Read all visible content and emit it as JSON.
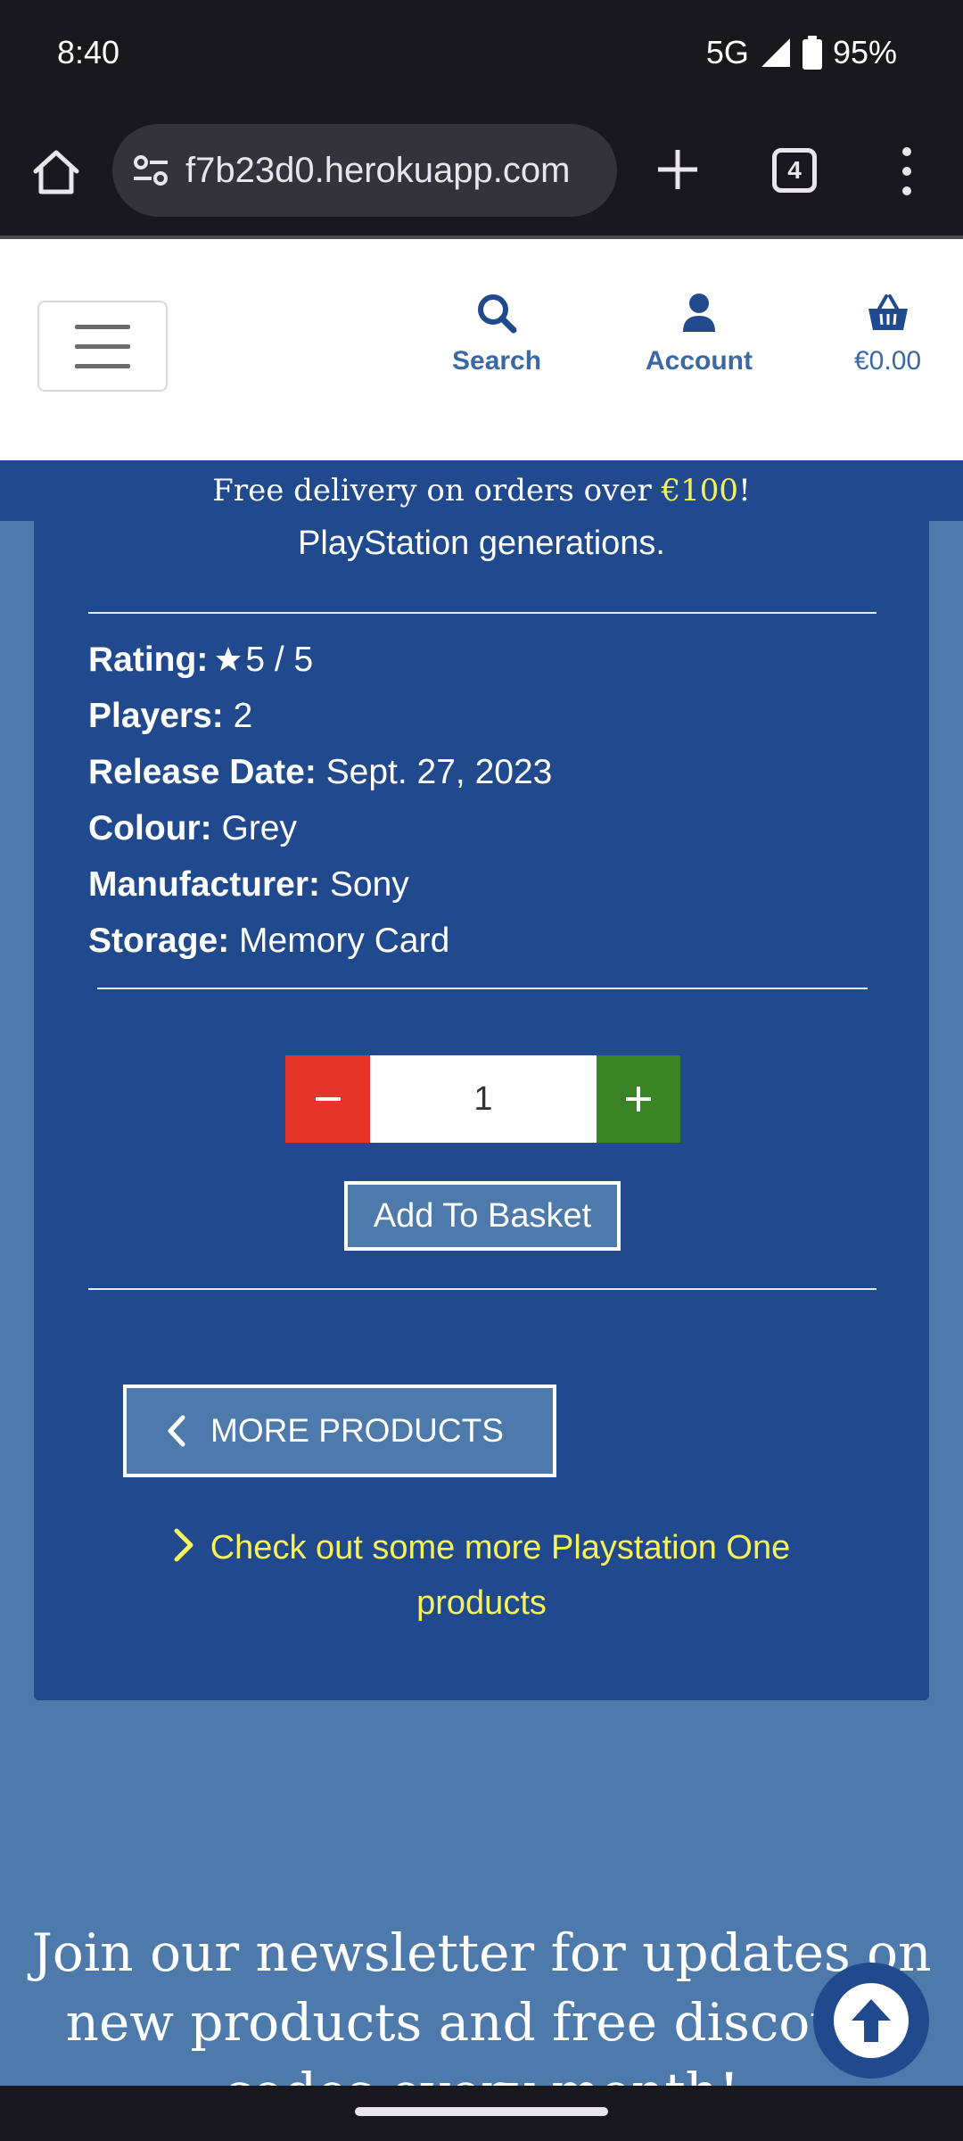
{
  "status_bar": {
    "time": "8:40",
    "network": "5G",
    "battery": "95%"
  },
  "browser": {
    "url": "f7b23d0.herokuapp.com",
    "tab_count": "4"
  },
  "header": {
    "search_label": "Search",
    "account_label": "Account",
    "basket_total": "€0.00"
  },
  "banner": {
    "prefix": "Free delivery on orders over ",
    "amount": "€100",
    "suffix": "!"
  },
  "product": {
    "description_tail": "PlayStation generations.",
    "specs": [
      {
        "label": "Rating:",
        "value": "5 / 5"
      },
      {
        "label": "Players:",
        "value": "2"
      },
      {
        "label": "Release Date:",
        "value": "Sept. 27, 2023"
      },
      {
        "label": "Colour:",
        "value": "Grey"
      },
      {
        "label": "Manufacturer:",
        "value": "Sony"
      },
      {
        "label": "Storage:",
        "value": "Memory Card"
      }
    ],
    "quantity": "1",
    "add_to_basket_label": "Add To Basket",
    "more_products_label": "MORE PRODUCTS",
    "check_out_link": "Check out some more Playstation One products"
  },
  "newsletter": {
    "heading": "Join our newsletter for updates on new products and free discount codes every month!"
  },
  "colors": {
    "primary_blue": "#214a8e",
    "page_blue": "#4d79ab",
    "accent_yellow": "#f6f25a",
    "minus_red": "#e6342b",
    "plus_green": "#3a8426"
  },
  "icons": {
    "home": "home-icon",
    "site_info": "tune-icon",
    "new_tab": "plus-icon",
    "menu": "more-vert-icon",
    "search": "search-icon",
    "account": "user-icon",
    "basket": "basket-icon",
    "star": "star-icon",
    "chevron_left": "chevron-left-icon",
    "chevron_right": "chevron-right-icon",
    "scroll_top": "arrow-up-icon"
  }
}
